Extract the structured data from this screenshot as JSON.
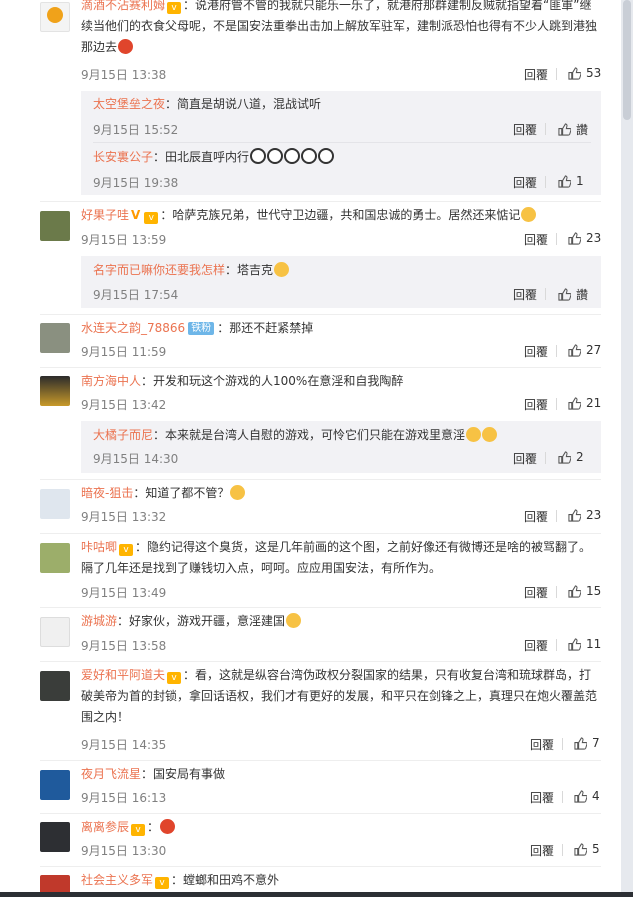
{
  "comments": [
    {
      "user": "滴酒不沾赛利姆",
      "text": "：说港府管不管的我就只能乐一乐了，就港府那群建制反贼就指望着“匪軍”继续当他们的衣食父母呢，不是国安法重拳出击加上解放军驻军，建制派恐怕也得有不少人跳到港独那边去",
      "time": "9月15日 13:38",
      "reply": "回覆",
      "likes": "53"
    },
    {
      "user": "好果子哇",
      "text": "：哈萨克族兄弟，世代守卫边疆，共和国忠诚的勇士。居然还来惦记",
      "time": "9月15日 13:59",
      "reply": "回覆",
      "likes": "23"
    },
    {
      "user": "水连天之韵_78866",
      "fan_badge": "铁粉",
      "text": "：那还不赶紧禁掉",
      "time": "9月15日 11:59",
      "reply": "回覆",
      "likes": "27"
    },
    {
      "user": "南方海中人",
      "text": "：开发和玩这个游戏的人100%在意淫和自我陶醉",
      "time": "9月15日 13:42",
      "reply": "回覆",
      "likes": "21"
    },
    {
      "user": "暗夜-狙击",
      "text": "：知道了都不管？",
      "time": "9月15日 13:32",
      "reply": "回覆",
      "likes": "23"
    },
    {
      "user": "咔咕唧",
      "text": "：隐约记得这个臭货，这是几年前画的这个图，之前好像还有微博还是啥的被骂翻了。隔了几年还是找到了赚钱切入点，呵呵。应应用国安法，有所作为。",
      "time": "9月15日 13:49",
      "reply": "回覆",
      "likes": "15"
    },
    {
      "user": "游城游",
      "text": "：好家伙，游戏开疆，意淫建国",
      "time": "9月15日 13:58",
      "reply": "回覆",
      "likes": "11"
    },
    {
      "user": "爱好和平阿道夫",
      "text": "：看，这就是纵容台湾伪政权分裂国家的结果，只有收复台湾和琉球群岛，打破美帝为首的封锁，拿回话语权，我们才有更好的发展，和平只在剑锋之上，真理只在炮火覆盖范围之内！",
      "time": "9月15日 14:35",
      "reply": "回覆",
      "likes": "7"
    },
    {
      "user": "夜月飞流星",
      "text": "：国安局有事做",
      "time": "9月15日 16:13",
      "reply": "回覆",
      "likes": "4"
    },
    {
      "user": "离离参辰",
      "text": "：",
      "time": "9月15日 13:30",
      "reply": "回覆",
      "likes": "5"
    },
    {
      "user": "社会主义多军",
      "text": "：螳螂和田鸡不意外"
    }
  ],
  "replies": [
    {
      "user": "太空堡垒之夜",
      "text": "：简直是胡说八道，混战试听",
      "time": "9月15日 15:52",
      "reply": "回覆",
      "likes": "讚"
    },
    {
      "user": "长安裏公子",
      "text": "：田北辰直呼内行",
      "time": "9月15日 19:38",
      "reply": "回覆",
      "likes": "1"
    },
    {
      "user": "名字而已嘛你还要我怎样",
      "text": "：塔吉克",
      "time": "9月15日 17:54",
      "reply": "回覆",
      "likes": "讚"
    },
    {
      "user": "大橘子而尼",
      "text": "：本来就是台湾人自慰的游戏，可怜它们只能在游戏里意淫",
      "time": "9月15日 14:30",
      "reply": "回覆",
      "likes": "2"
    }
  ],
  "colors": {
    "username": "#eb7350",
    "time": "#808080",
    "background": "#a9c9e8",
    "reply_box": "#f2f2f5"
  }
}
